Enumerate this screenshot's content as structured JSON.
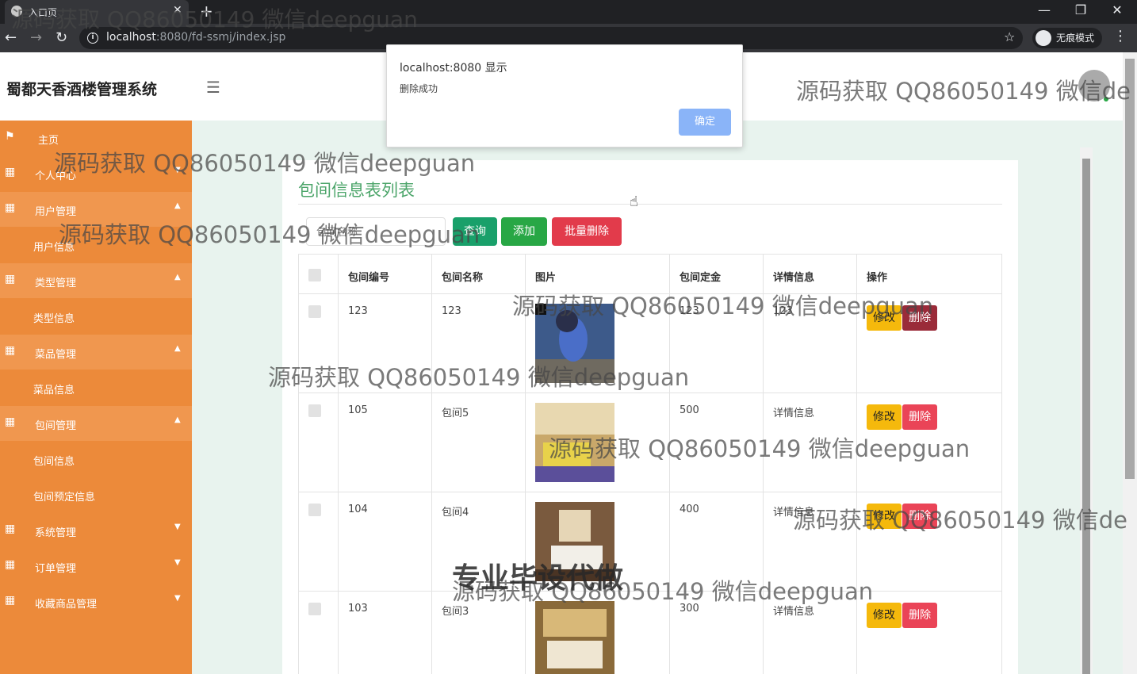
{
  "browser": {
    "tab_title": "入口页",
    "url_host": "localhost",
    "url_rest": ":8080/fd-ssmj/index.jsp",
    "incognito_label": "无痕模式"
  },
  "app": {
    "title": "蜀都天香酒楼管理系统"
  },
  "sidebar": {
    "items": [
      {
        "label": "主页",
        "icon": "flag-icon"
      },
      {
        "label": "个人中心",
        "icon": "grid-icon",
        "caret": "down"
      },
      {
        "label": "用户管理",
        "icon": "grid-icon",
        "caret": "up",
        "sub": [
          "用户信息"
        ]
      },
      {
        "label": "类型管理",
        "icon": "grid-icon",
        "caret": "up",
        "sub": [
          "类型信息"
        ]
      },
      {
        "label": "菜品管理",
        "icon": "grid-icon",
        "caret": "up",
        "sub": [
          "菜品信息"
        ]
      },
      {
        "label": "包间管理",
        "icon": "grid-icon",
        "caret": "up",
        "sub": [
          "包间信息",
          "包间预定信息"
        ]
      },
      {
        "label": "系统管理",
        "icon": "grid-icon",
        "caret": "down"
      },
      {
        "label": "订单管理",
        "icon": "grid-icon",
        "caret": "down"
      },
      {
        "label": "收藏商品管理",
        "icon": "grid-icon",
        "caret": "down"
      }
    ]
  },
  "main": {
    "title": "包间信息表列表",
    "search_placeholder": "包间名称",
    "buttons": {
      "query": "查询",
      "add": "添加",
      "batch_delete": "批量删除"
    },
    "columns": [
      "包间编号",
      "包间名称",
      "图片",
      "包间定金",
      "详情信息",
      "操作"
    ],
    "rows": [
      {
        "id": "123",
        "name": "123",
        "deposit": "123",
        "detail": "123"
      },
      {
        "id": "105",
        "name": "包间5",
        "deposit": "500",
        "detail": "详情信息"
      },
      {
        "id": "104",
        "name": "包间4",
        "deposit": "400",
        "detail": "详情信息"
      },
      {
        "id": "103",
        "name": "包间3",
        "deposit": "300",
        "detail": "详情信息"
      }
    ],
    "row_actions": {
      "edit": "修改",
      "delete": "删除"
    }
  },
  "alert": {
    "title": "localhost:8080 显示",
    "message": "删除成功",
    "ok": "确定"
  },
  "watermark": {
    "text": "源码获取 QQ86050149 微信deepguan",
    "text_cut": "源码获取 QQ86050149 微信de",
    "big": "专业毕设代做"
  }
}
